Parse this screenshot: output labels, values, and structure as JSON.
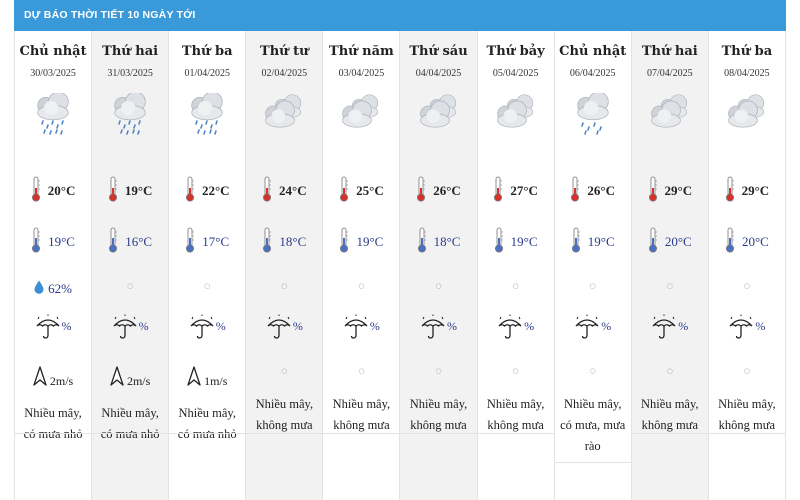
{
  "header": {
    "title": "DỰ BÁO THỜI TIẾT 10 NGÀY TỚI"
  },
  "days": [
    {
      "day": "Chủ nhật",
      "date": "30/03/2025",
      "icon": "cloud-rain-icon",
      "tmax": "20°C",
      "tmin": "19°C",
      "humidity": "62%",
      "rain": "%",
      "wind": "2m/s",
      "desc": "Nhiều mây, có mưa nhỏ"
    },
    {
      "day": "Thứ hai",
      "date": "31/03/2025",
      "icon": "cloud-rain-icon",
      "tmax": "19°C",
      "tmin": "16°C",
      "humidity": "",
      "rain": "%",
      "wind": "2m/s",
      "desc": "Nhiều mây, có mưa nhỏ"
    },
    {
      "day": "Thứ ba",
      "date": "01/04/2025",
      "icon": "cloud-rain-icon",
      "tmax": "22°C",
      "tmin": "17°C",
      "humidity": "",
      "rain": "%",
      "wind": "1m/s",
      "desc": "Nhiều mây, có mưa nhỏ"
    },
    {
      "day": "Thứ tư",
      "date": "02/04/2025",
      "icon": "cloudy-icon",
      "tmax": "24°C",
      "tmin": "18°C",
      "humidity": "",
      "rain": "%",
      "wind": "",
      "desc": "Nhiều mây, không mưa"
    },
    {
      "day": "Thứ năm",
      "date": "03/04/2025",
      "icon": "cloudy-icon",
      "tmax": "25°C",
      "tmin": "19°C",
      "humidity": "",
      "rain": "%",
      "wind": "",
      "desc": "Nhiều mây, không mưa"
    },
    {
      "day": "Thứ sáu",
      "date": "04/04/2025",
      "icon": "cloudy-icon",
      "tmax": "26°C",
      "tmin": "18°C",
      "humidity": "",
      "rain": "%",
      "wind": "",
      "desc": "Nhiều mây, không mưa"
    },
    {
      "day": "Thứ bảy",
      "date": "05/04/2025",
      "icon": "cloudy-icon",
      "tmax": "27°C",
      "tmin": "19°C",
      "humidity": "",
      "rain": "%",
      "wind": "",
      "desc": "Nhiều mây, không mưa"
    },
    {
      "day": "Chủ nhật",
      "date": "06/04/2025",
      "icon": "cloud-showers-icon",
      "tmax": "26°C",
      "tmin": "19°C",
      "humidity": "",
      "rain": "%",
      "wind": "",
      "desc": "Nhiều mây, có mưa, mưa rào"
    },
    {
      "day": "Thứ hai",
      "date": "07/04/2025",
      "icon": "cloudy-icon",
      "tmax": "29°C",
      "tmin": "20°C",
      "humidity": "",
      "rain": "%",
      "wind": "",
      "desc": "Nhiều mây, không mưa"
    },
    {
      "day": "Thứ ba",
      "date": "08/04/2025",
      "icon": "cloudy-icon",
      "tmax": "29°C",
      "tmin": "20°C",
      "humidity": "",
      "rain": "%",
      "wind": "",
      "desc": "Nhiều mây, không mưa"
    }
  ],
  "colors": {
    "header_bg": "#3a9ad9",
    "alt_col_bg": "#f2f2f2",
    "min_temp": "#2b3a8a",
    "therm_red": "#d9302b"
  }
}
